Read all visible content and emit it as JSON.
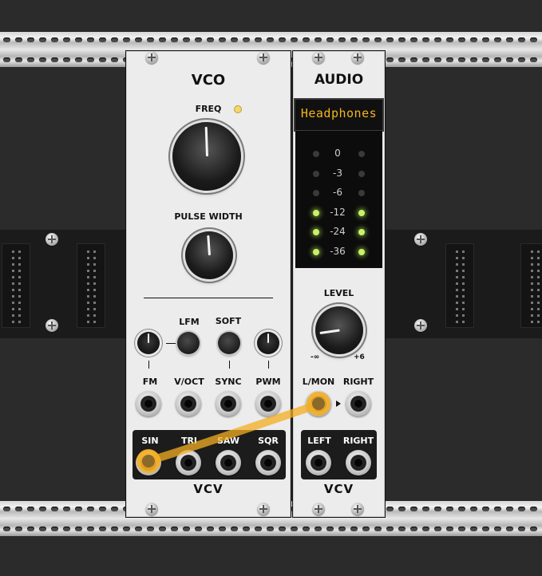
{
  "vco": {
    "title": "VCO",
    "freq_label": "FREQ",
    "pulse_width_label": "PULSE WIDTH",
    "lfm_label": "LFM",
    "soft_label": "SOFT",
    "inputs": [
      "FM",
      "V/OCT",
      "SYNC",
      "PWM"
    ],
    "outputs": [
      "SIN",
      "TRI",
      "SAW",
      "SQR"
    ],
    "logo": "VCV"
  },
  "audio": {
    "title": "AUDIO",
    "device": "Headphones",
    "meter_levels": [
      "0",
      "-3",
      "-6",
      "-12",
      "-24",
      "-36"
    ],
    "meter_lit": [
      false,
      false,
      false,
      true,
      true,
      true
    ],
    "level_label": "LEVEL",
    "level_min": "-∞",
    "level_max": "+6",
    "inputs": [
      "L/MON",
      "RIGHT"
    ],
    "outputs": [
      "LEFT",
      "RIGHT"
    ],
    "logo": "VCV"
  },
  "cable": {
    "color": "#f3ad22",
    "from": "SIN",
    "to": "L/MON"
  },
  "colors": {
    "led_yellow": "#f5d66a",
    "display_text": "#f2b51c",
    "meter_on": "#c9f26a"
  }
}
